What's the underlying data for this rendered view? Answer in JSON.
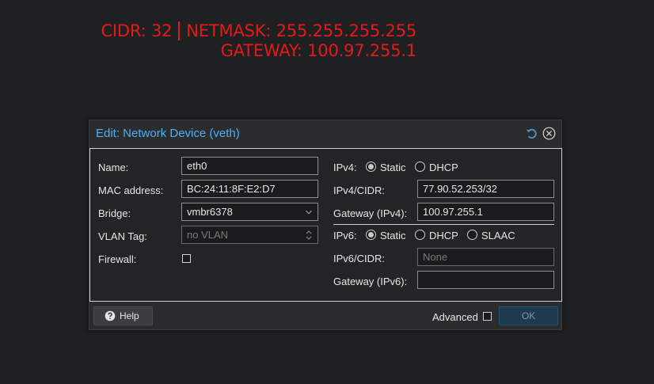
{
  "annotation": {
    "cidr": "CIDR: 32",
    "netmask": "NETMASK: 255.255.255.255",
    "gateway": "GATEWAY: 100.97.255.1"
  },
  "dialog": {
    "title": "Edit: Network Device (veth)",
    "reset_icon": "reset-icon",
    "close_icon": "close-icon"
  },
  "left": {
    "name_label": "Name:",
    "name_value": "eth0",
    "mac_label": "MAC address:",
    "mac_value": "BC:24:11:8F:E2:D7",
    "bridge_label": "Bridge:",
    "bridge_value": "vmbr6378",
    "vlan_label": "VLAN Tag:",
    "vlan_placeholder": "no VLAN",
    "firewall_label": "Firewall:",
    "firewall_checked": false
  },
  "ipv4": {
    "label": "IPv4:",
    "options": [
      "Static",
      "DHCP"
    ],
    "selected": "Static",
    "cidr_label": "IPv4/CIDR:",
    "cidr_value": "77.90.52.253/32",
    "gateway_label": "Gateway (IPv4):",
    "gateway_value": "100.97.255.1"
  },
  "ipv6": {
    "label": "IPv6:",
    "options": [
      "Static",
      "DHCP",
      "SLAAC"
    ],
    "selected": "Static",
    "cidr_label": "IPv6/CIDR:",
    "cidr_placeholder": "None",
    "gateway_label": "Gateway (IPv6):",
    "gateway_value": ""
  },
  "footer": {
    "help_label": "Help",
    "advanced_label": "Advanced",
    "advanced_checked": false,
    "ok_label": "OK"
  },
  "colors": {
    "accent": "#4db0f0",
    "annotation": "#e31a1a",
    "ok_button": "#1e3a4f"
  }
}
